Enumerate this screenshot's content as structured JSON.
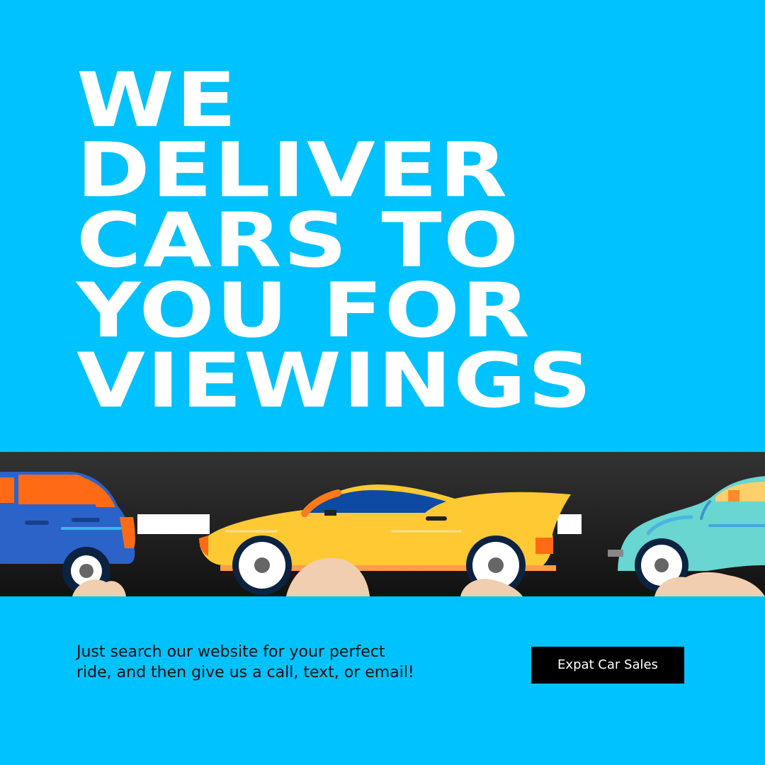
{
  "headline": {
    "lines": [
      "WE",
      "DELIVER",
      "CARS TO",
      "YOU FOR",
      "VIEWINGS"
    ]
  },
  "tagline": {
    "line1": "Just search our website for your perfect",
    "line2": "ride, and then give us a call, text, or email!"
  },
  "brand_button": {
    "label": "Expat Car Sales"
  },
  "colors": {
    "background": "#00c2ff",
    "road": "#1e1e1e",
    "lane_marking": "#ffffff",
    "blue_car": "#2b63c9",
    "yellow_car": "#ffc934",
    "teal_car": "#69d6d2",
    "button": "#000000",
    "button_text": "#ffffff"
  },
  "icons": {
    "road_scene": "road-illustration",
    "left_car": "blue-minivan-icon",
    "center_car": "yellow-sports-car-icon",
    "right_car": "teal-vintage-car-icon"
  }
}
